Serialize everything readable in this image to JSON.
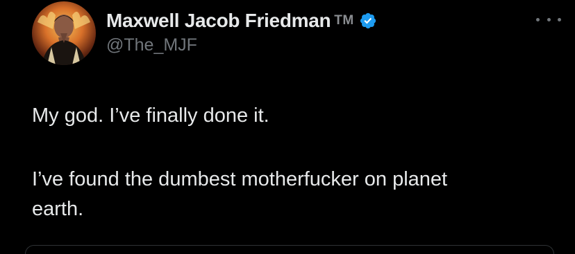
{
  "tweet": {
    "author": {
      "display_name": "Maxwell Jacob Friedman",
      "trademark": "TM",
      "handle": "@The_MJF",
      "verified": true,
      "avatar_icon": "profile-photo",
      "verified_icon": "verified-badge-icon",
      "verified_color": "#1d9bf0"
    },
    "more_icon": "more-options-icon",
    "text_lines": [
      "My god. I’ve finally done it.",
      "I’ve found the dumbest motherfucker on planet",
      "earth."
    ]
  },
  "colors": {
    "background": "#000000",
    "primary_text": "#e7e9ea",
    "secondary_text": "#71767b",
    "accent": "#1d9bf0"
  }
}
